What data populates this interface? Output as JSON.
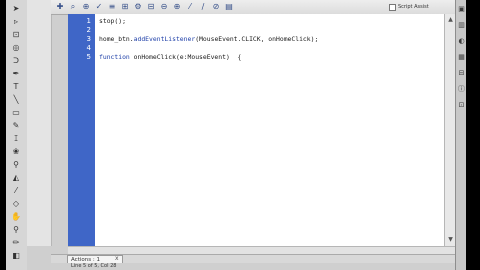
{
  "editor": {
    "lines": [
      {
        "num": "1",
        "code": "stop();"
      },
      {
        "num": "2",
        "code": ""
      },
      {
        "num": "3",
        "code_pre": "home_btn.",
        "code_kw": "addEventListener",
        "code_post": "(MouseEvent.CLICK, onHomeClick);"
      },
      {
        "num": "4",
        "code": ""
      },
      {
        "num": "5",
        "code_kw": "function",
        "code_post": " onHomeClick(e:MouseEvent)  {"
      }
    ]
  },
  "toolbar": {
    "script_assist_label": "Script Assist",
    "icons": [
      "add-icon",
      "find-icon",
      "target-icon",
      "check-syntax-icon",
      "auto-format-icon",
      "code-hint-icon",
      "debug-icon",
      "collapse-icon",
      "collapse-selection-icon",
      "expand-icon",
      "comment-icon",
      "line-comment-icon",
      "uncomment-icon",
      "toggle-panel-icon"
    ]
  },
  "tabbar": {
    "tab_label": "Actions : 1",
    "close_symbol": "x"
  },
  "status": {
    "text": "Line 5 of 5, Col 28"
  }
}
